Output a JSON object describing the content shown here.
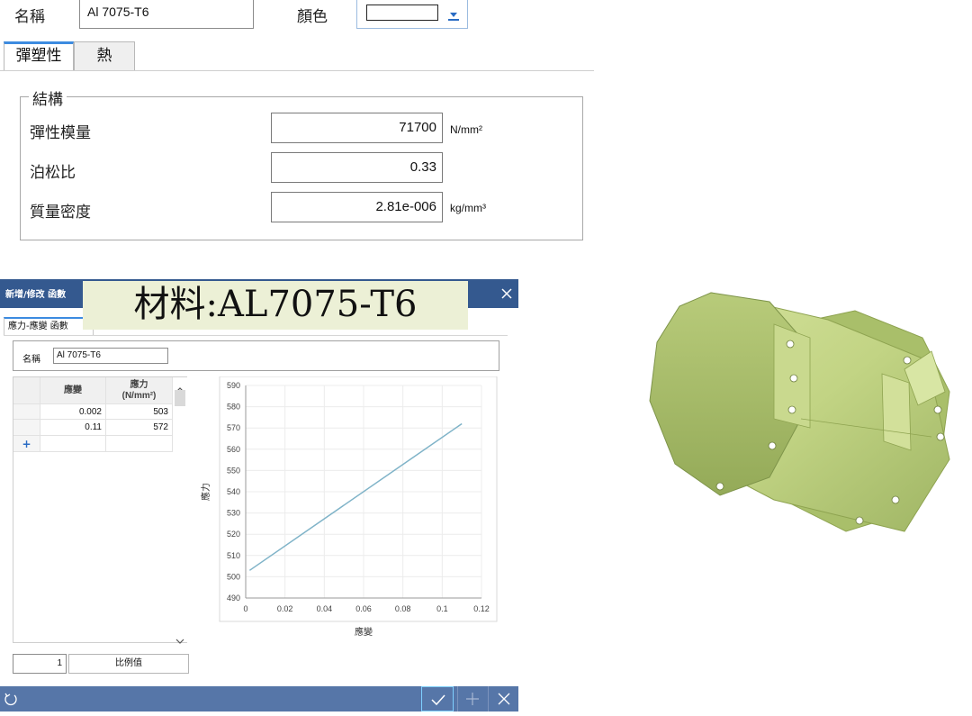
{
  "material_panel": {
    "name_label": "名稱",
    "name_value": "Al 7075-T6",
    "color_label": "顏色",
    "tabs": [
      {
        "label": "彈塑性",
        "active": true
      },
      {
        "label": "熱",
        "active": false
      }
    ],
    "group_label": "結構",
    "properties": [
      {
        "label": "彈性模量",
        "value": "71700",
        "unit": "N/mm²"
      },
      {
        "label": "泊松比",
        "value": "0.33",
        "unit": ""
      },
      {
        "label": "質量密度",
        "value": "2.81e-006",
        "unit": "kg/mm³"
      }
    ]
  },
  "dialog": {
    "title": "新增/修改 函數",
    "overlay_title": "材料:AL7075-T6",
    "tab_label": "應力-應變 函數",
    "name_label": "名稱",
    "name_value": "Al 7075-T6",
    "table": {
      "columns": [
        "應變",
        "應力\n(N/mm²)"
      ],
      "rows": [
        [
          "0.002",
          "503"
        ],
        [
          "0.11",
          "572"
        ]
      ],
      "add_row_label": "+"
    },
    "scale_value": "1",
    "scale_button_label": "比例值",
    "colors": {
      "titlebar": "#34598f",
      "bottom_bar": "#5676a8",
      "line": "#7fb3c8"
    }
  },
  "chart_data": {
    "type": "line",
    "series": [
      {
        "x": [
          0.002,
          0.11
        ],
        "y": [
          503,
          572
        ]
      }
    ],
    "xlabel": "應變",
    "ylabel": "應力",
    "xlim": [
      0,
      0.12
    ],
    "ylim": [
      490,
      590
    ],
    "xticks": [
      "0",
      "0.02",
      "0.04",
      "0.06",
      "0.08",
      "0.1",
      "0.12"
    ],
    "yticks": [
      "490",
      "500",
      "510",
      "520",
      "530",
      "540",
      "550",
      "560",
      "570",
      "580",
      "590"
    ],
    "grid": true
  },
  "model_view": {
    "color": "#c9d98e"
  }
}
